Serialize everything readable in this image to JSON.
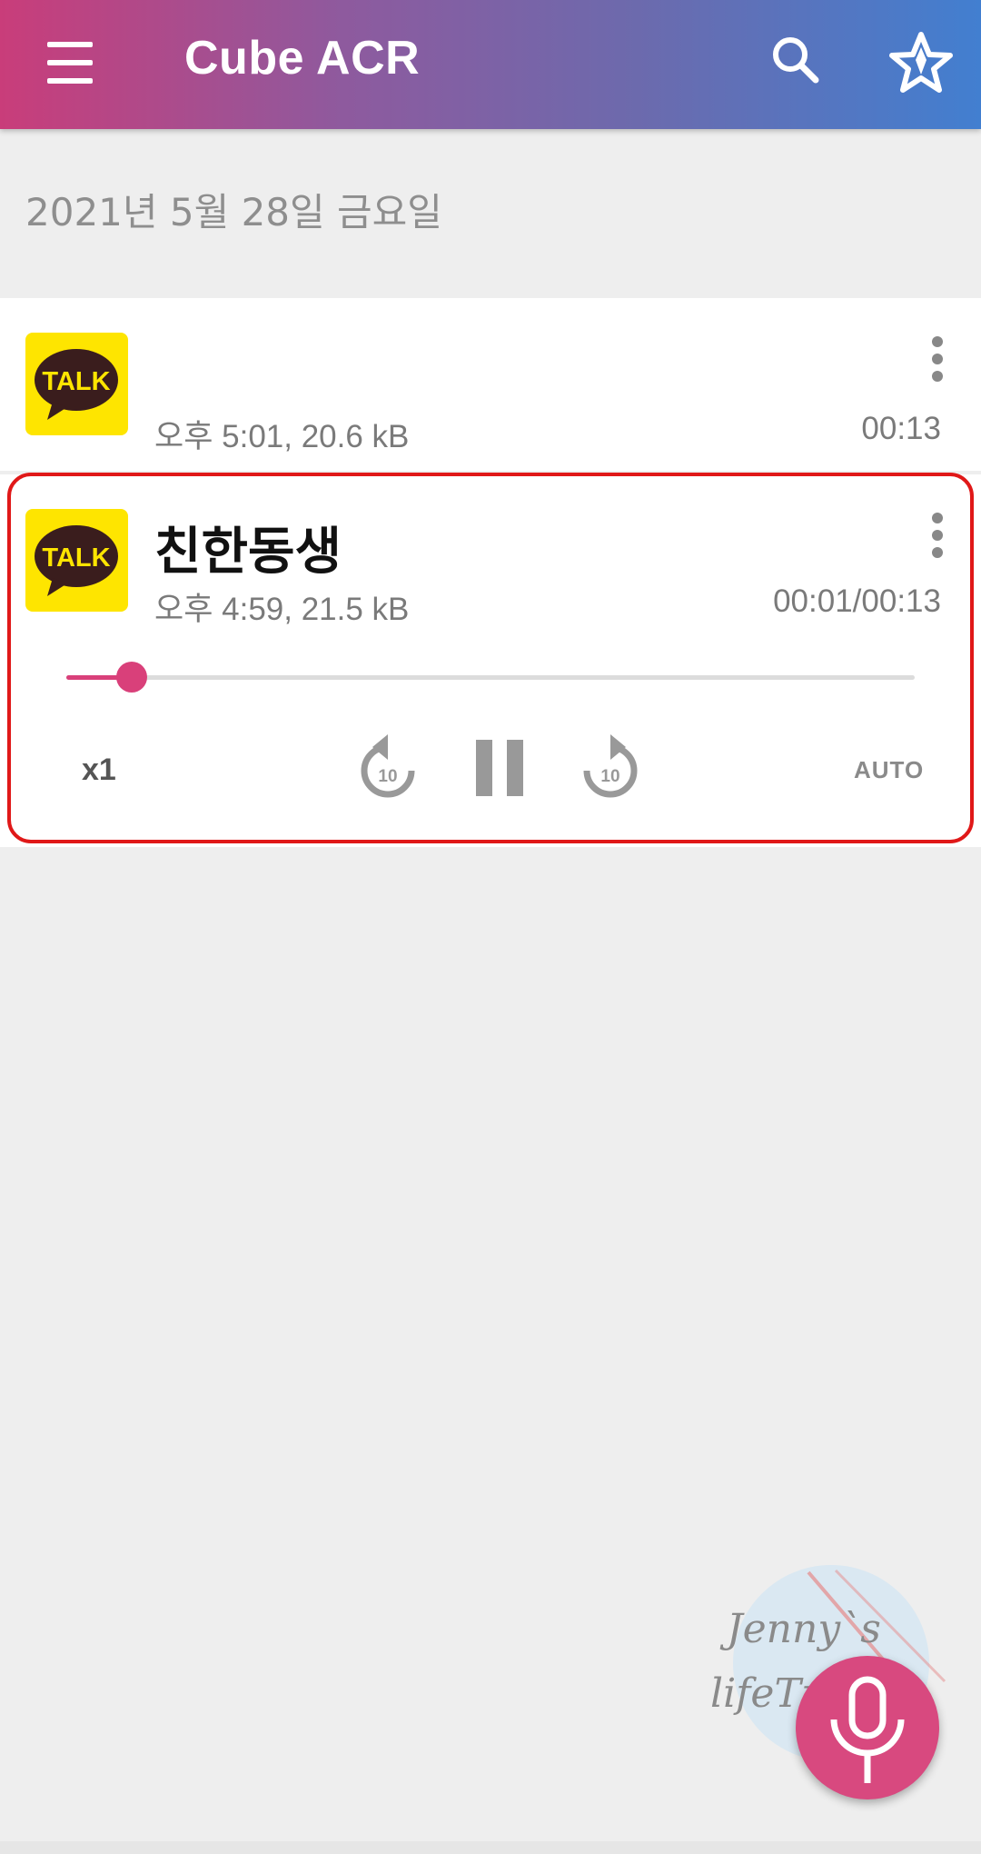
{
  "app_bar": {
    "title": "Cube ACR",
    "icons": [
      "menu-icon",
      "search-icon",
      "star-icon"
    ]
  },
  "date_header": "2021년 5월 28일 금요일",
  "recordings": [
    {
      "app_icon": "kakaotalk-icon",
      "icon_text": "TALK",
      "contact": "",
      "meta": "오후 5:01, 20.6 kB",
      "duration": "00:13"
    },
    {
      "app_icon": "kakaotalk-icon",
      "icon_text": "TALK",
      "contact": "친한동생",
      "meta": "오후 4:59, 21.5 kB",
      "duration": "00:01/00:13",
      "playback_progress": 0.077
    }
  ],
  "player": {
    "speed": "x1",
    "rewind_seconds": "10",
    "forward_seconds": "10",
    "auto_label": "AUTO"
  },
  "watermark": {
    "line1": "Jenny`s",
    "line2": "lifeTravel"
  },
  "colors": {
    "accent": "#d9407a",
    "highlight": "#e01818",
    "kakao_yellow": "#fee500"
  }
}
